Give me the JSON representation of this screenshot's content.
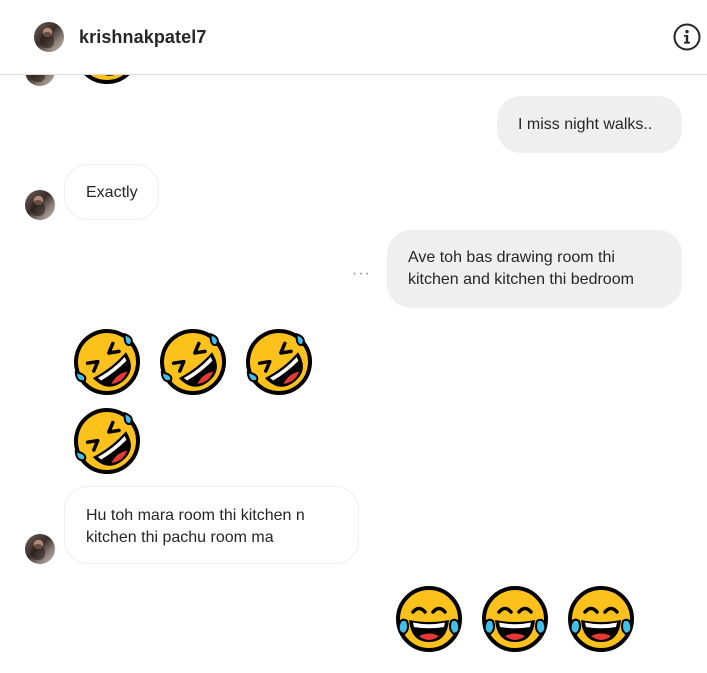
{
  "header": {
    "username": "krishnakpatel7",
    "info_icon": "info-circle-icon"
  },
  "messages": [
    {
      "id": "m1",
      "direction": "outgoing",
      "text": "I miss night walks.."
    },
    {
      "id": "m2",
      "direction": "incoming",
      "text": "Exactly"
    },
    {
      "id": "m3",
      "direction": "outgoing",
      "lines": [
        "Ave toh bas drawing room thi",
        "kitchen and kitchen thi bedroom"
      ]
    },
    {
      "id": "m4",
      "direction": "incoming",
      "emoji": "rolling-on-floor-laughing",
      "count": 4
    },
    {
      "id": "m5",
      "direction": "incoming",
      "lines": [
        "Hu toh mara room thi kitchen n",
        "kitchen thi pachu room ma"
      ]
    },
    {
      "id": "m6",
      "direction": "outgoing",
      "emoji": "face-with-tears-of-joy",
      "count": 3
    }
  ],
  "colors": {
    "outgoing_bubble": "#efefef",
    "incoming_border": "#efefef",
    "emoji_face": "#FCC21B",
    "emoji_tear": "#40C0E7"
  }
}
